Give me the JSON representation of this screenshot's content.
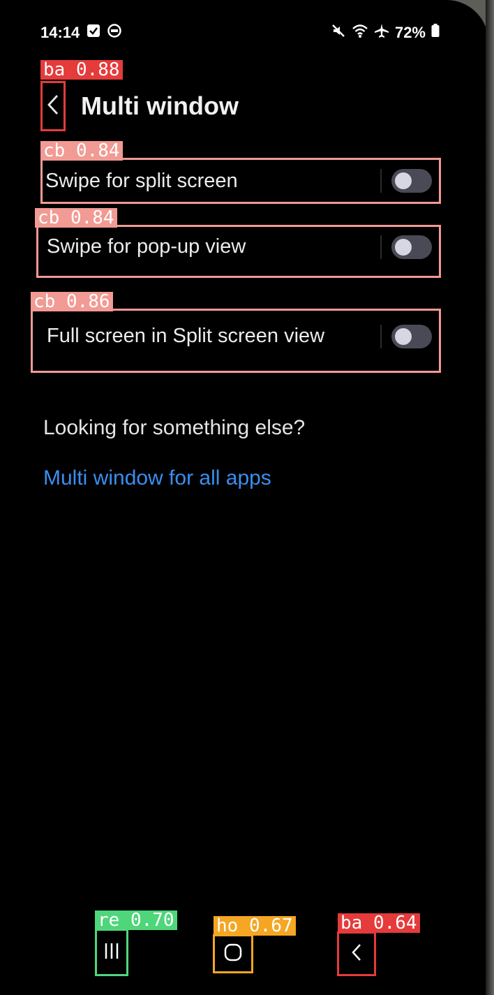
{
  "status_bar": {
    "time": "14:14",
    "battery": "72%"
  },
  "header": {
    "title": "Multi window"
  },
  "settings": [
    {
      "label": "Swipe for split screen",
      "enabled": false,
      "annotation": "cb 0.84"
    },
    {
      "label": "Swipe for pop-up view",
      "enabled": false,
      "annotation": "cb 0.84"
    },
    {
      "label": "Full screen in Split screen view",
      "enabled": false,
      "annotation": "cb 0.86"
    }
  ],
  "suggestions": {
    "heading": "Looking for something else?",
    "link": "Multi window for all apps"
  },
  "annotations": {
    "back": "ba 0.88",
    "recents": "re 0.70",
    "home": "ho 0.67",
    "nav_back": "ba 0.64"
  },
  "colors": {
    "background": "#000000",
    "link": "#3a8fef",
    "toggle_track": "#4a4a57",
    "annot_back": "#e53b3b",
    "annot_checkbox": "#f29a94",
    "annot_recents": "#4fd67a",
    "annot_home": "#f5a623"
  },
  "icons": {
    "status_left": [
      "check-box-icon",
      "messenger-icon"
    ],
    "status_right": [
      "mute-icon",
      "wifi-icon",
      "airplane-icon",
      "battery-icon"
    ],
    "nav": [
      "recents-icon",
      "home-icon",
      "back-icon"
    ]
  }
}
